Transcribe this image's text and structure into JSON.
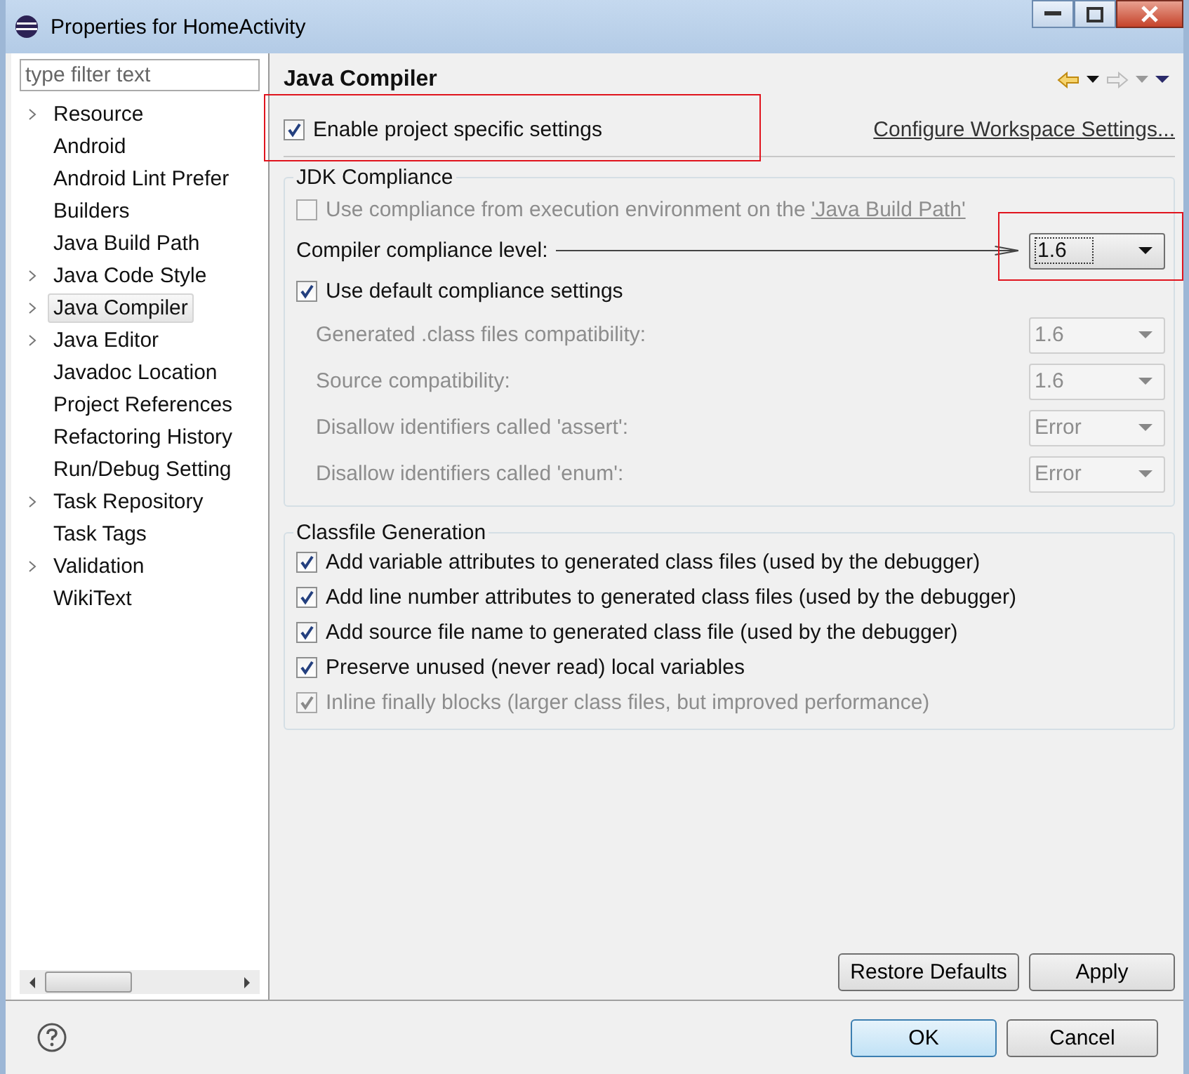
{
  "window": {
    "title": "Properties for HomeActivity"
  },
  "filter": {
    "placeholder": "type filter text"
  },
  "tree": [
    {
      "label": "Resource",
      "expandable": true,
      "selected": false
    },
    {
      "label": "Android",
      "expandable": false,
      "selected": false
    },
    {
      "label": "Android Lint Prefer",
      "expandable": false,
      "selected": false
    },
    {
      "label": "Builders",
      "expandable": false,
      "selected": false
    },
    {
      "label": "Java Build Path",
      "expandable": false,
      "selected": false
    },
    {
      "label": "Java Code Style",
      "expandable": true,
      "selected": false
    },
    {
      "label": "Java Compiler",
      "expandable": true,
      "selected": true
    },
    {
      "label": "Java Editor",
      "expandable": true,
      "selected": false
    },
    {
      "label": "Javadoc Location",
      "expandable": false,
      "selected": false
    },
    {
      "label": "Project References",
      "expandable": false,
      "selected": false
    },
    {
      "label": "Refactoring History",
      "expandable": false,
      "selected": false
    },
    {
      "label": "Run/Debug Setting",
      "expandable": false,
      "selected": false
    },
    {
      "label": "Task Repository",
      "expandable": true,
      "selected": false
    },
    {
      "label": "Task Tags",
      "expandable": false,
      "selected": false
    },
    {
      "label": "Validation",
      "expandable": true,
      "selected": false
    },
    {
      "label": "WikiText",
      "expandable": false,
      "selected": false
    }
  ],
  "page": {
    "title": "Java Compiler",
    "enable_specific": {
      "label": "Enable project specific settings",
      "checked": true,
      "highlighted": true
    },
    "configure_link": "Configure Workspace Settings...",
    "jdk_compliance": {
      "title": "JDK Compliance",
      "use_env": {
        "label": "Use compliance from execution environment on the",
        "link": "'Java Build Path'",
        "checked": false,
        "disabled": true
      },
      "level": {
        "label": "Compiler compliance level:",
        "value": "1.6",
        "highlighted": true,
        "arrow": true
      },
      "use_default": {
        "label": "Use default compliance settings",
        "checked": true
      },
      "settings": [
        {
          "label": "Generated .class files compatibility:",
          "value": "1.6",
          "disabled": true
        },
        {
          "label": "Source compatibility:",
          "value": "1.6",
          "disabled": true
        },
        {
          "label": "Disallow identifiers called 'assert':",
          "value": "Error",
          "disabled": true
        },
        {
          "label": "Disallow identifiers called 'enum':",
          "value": "Error",
          "disabled": true
        }
      ]
    },
    "classfile": {
      "title": "Classfile Generation",
      "options": [
        {
          "label": "Add variable attributes to generated class files (used by the debugger)",
          "checked": true,
          "disabled": false
        },
        {
          "label": "Add line number attributes to generated class files (used by the debugger)",
          "checked": true,
          "disabled": false
        },
        {
          "label": "Add source file name to generated class file (used by the debugger)",
          "checked": true,
          "disabled": false
        },
        {
          "label": "Preserve unused (never read) local variables",
          "checked": true,
          "disabled": false
        },
        {
          "label": "Inline finally blocks (larger class files, but improved performance)",
          "checked": true,
          "disabled": true
        }
      ]
    },
    "restore_button": "Restore Defaults",
    "apply_button": "Apply"
  },
  "footer": {
    "ok_button": "OK",
    "cancel_button": "Cancel"
  }
}
